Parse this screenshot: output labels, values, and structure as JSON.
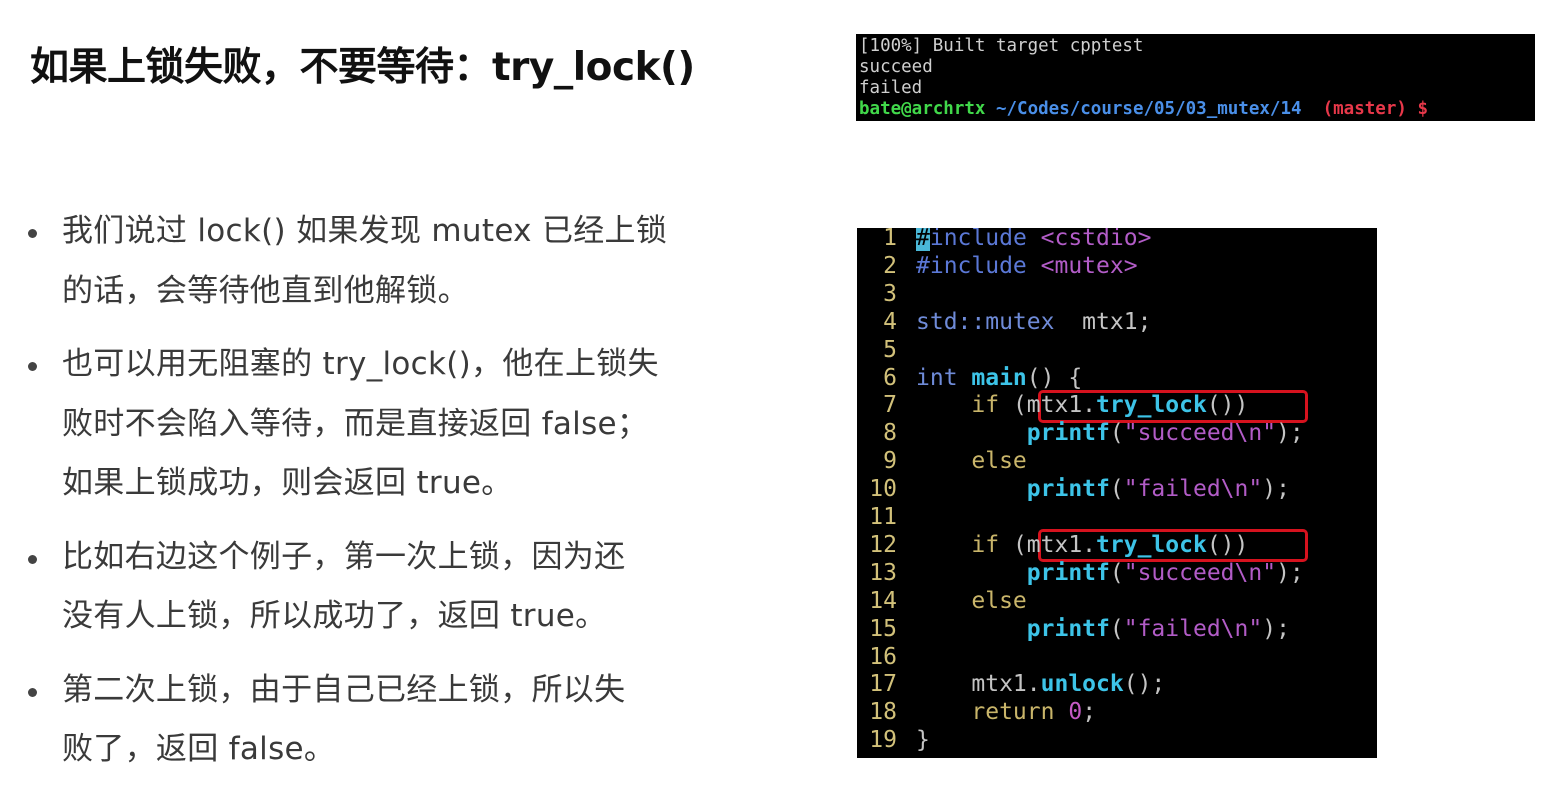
{
  "slide": {
    "title": "如果上锁失败，不要等待：try_lock()",
    "bullets": [
      "我们说过 lock() 如果发现 mutex 已经上锁\n的话，会等待他直到他解锁。",
      "也可以用无阻塞的 try_lock()，他在上锁失\n败时不会陷入等待，而是直接返回 false；\n如果上锁成功，则会返回 true。",
      "比如右边这个例子，第一次上锁，因为还\n没有人上锁，所以成功了，返回 true。",
      "第二次上锁，由于自己已经上锁，所以失\n败了，返回 false。"
    ]
  },
  "terminal": {
    "build_line": "[100%] Built target cpptest",
    "output_lines": [
      "succeed",
      "failed"
    ],
    "prompt": {
      "user_host": "bate@archrtx",
      "path": "~/Codes/course/05/03_mutex/14",
      "branch": "(master)",
      "symbol": "$"
    }
  },
  "code": {
    "lines": [
      {
        "n": "1",
        "parts": [
          [
            "cursor",
            "#"
          ],
          [
            "c-pre",
            "include "
          ],
          [
            "c-str",
            "<cstdio>"
          ]
        ]
      },
      {
        "n": "2",
        "parts": [
          [
            "c-pre",
            "#include "
          ],
          [
            "c-str",
            "<mutex>"
          ]
        ]
      },
      {
        "n": "3",
        "parts": []
      },
      {
        "n": "4",
        "parts": [
          [
            "c-type",
            "std::mutex"
          ],
          [
            "",
            "  mtx1;"
          ]
        ]
      },
      {
        "n": "5",
        "parts": []
      },
      {
        "n": "6",
        "parts": [
          [
            "c-type",
            "int "
          ],
          [
            "c-fn",
            "main"
          ],
          [
            "",
            "() {"
          ]
        ]
      },
      {
        "n": "7",
        "parts": [
          [
            "",
            "    "
          ],
          [
            "c-kw",
            "if "
          ],
          [
            "",
            "(mtx1."
          ],
          [
            "c-fn",
            "try_lock"
          ],
          [
            "",
            "())"
          ]
        ]
      },
      {
        "n": "8",
        "parts": [
          [
            "",
            "        "
          ],
          [
            "c-fn",
            "printf"
          ],
          [
            "",
            "("
          ],
          [
            "c-str",
            "\"succeed\\n\""
          ],
          [
            "",
            ");"
          ]
        ]
      },
      {
        "n": "9",
        "parts": [
          [
            "",
            "    "
          ],
          [
            "c-kw",
            "else"
          ]
        ]
      },
      {
        "n": "10",
        "parts": [
          [
            "",
            "        "
          ],
          [
            "c-fn",
            "printf"
          ],
          [
            "",
            "("
          ],
          [
            "c-str",
            "\"failed\\n\""
          ],
          [
            "",
            ");"
          ]
        ]
      },
      {
        "n": "11",
        "parts": []
      },
      {
        "n": "12",
        "parts": [
          [
            "",
            "    "
          ],
          [
            "c-kw",
            "if "
          ],
          [
            "",
            "(mtx1."
          ],
          [
            "c-fn",
            "try_lock"
          ],
          [
            "",
            "())"
          ]
        ]
      },
      {
        "n": "13",
        "parts": [
          [
            "",
            "        "
          ],
          [
            "c-fn",
            "printf"
          ],
          [
            "",
            "("
          ],
          [
            "c-str",
            "\"succeed\\n\""
          ],
          [
            "",
            ");"
          ]
        ]
      },
      {
        "n": "14",
        "parts": [
          [
            "",
            "    "
          ],
          [
            "c-kw",
            "else"
          ]
        ]
      },
      {
        "n": "15",
        "parts": [
          [
            "",
            "        "
          ],
          [
            "c-fn",
            "printf"
          ],
          [
            "",
            "("
          ],
          [
            "c-str",
            "\"failed\\n\""
          ],
          [
            "",
            ");"
          ]
        ]
      },
      {
        "n": "16",
        "parts": []
      },
      {
        "n": "17",
        "parts": [
          [
            "",
            "    mtx1."
          ],
          [
            "c-fn",
            "unlock"
          ],
          [
            "",
            "();"
          ]
        ]
      },
      {
        "n": "18",
        "parts": [
          [
            "",
            "    "
          ],
          [
            "c-kw",
            "return "
          ],
          [
            "c-num",
            "0"
          ],
          [
            "",
            ";"
          ]
        ]
      },
      {
        "n": "19",
        "parts": [
          [
            "",
            "}"
          ]
        ]
      }
    ]
  },
  "colors": {
    "highlight_box": "#d6121e",
    "terminal_bg": "#000000"
  }
}
